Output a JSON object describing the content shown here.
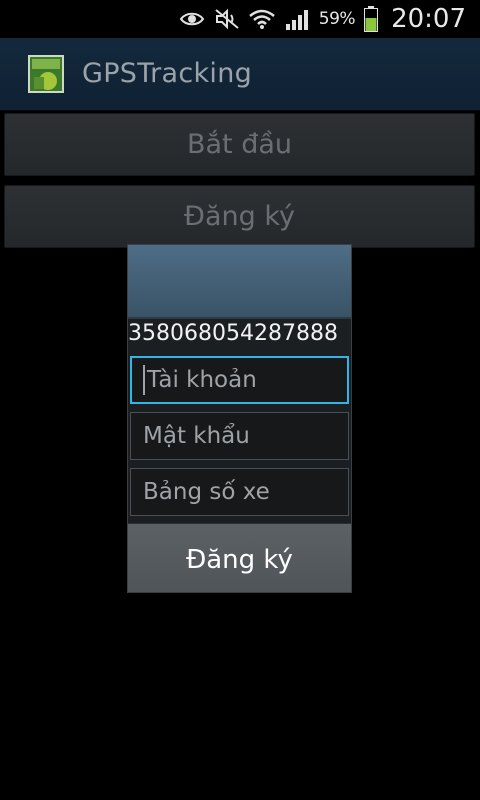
{
  "status_bar": {
    "icons": [
      "eye-icon",
      "mute-icon",
      "wifi-icon",
      "signal-icon",
      "battery-icon"
    ],
    "battery_percent": "59%",
    "time": "20:07",
    "battery_level": 0.59,
    "colors": {
      "battery_fill": "#8cc63e"
    }
  },
  "action_bar": {
    "title": "GPSTracking",
    "icon": "android-app-icon"
  },
  "main": {
    "start_button": "Bắt đầu",
    "register_button": "Đăng ký"
  },
  "dialog": {
    "device_id": "358068054287888",
    "account_placeholder": "Tài khoản",
    "password_placeholder": "Mật khẩu",
    "plate_placeholder": "Bảng số xe",
    "submit_button": "Đăng ký",
    "colors": {
      "focus_border": "#33b5e5",
      "header": "#4e6d86"
    }
  }
}
